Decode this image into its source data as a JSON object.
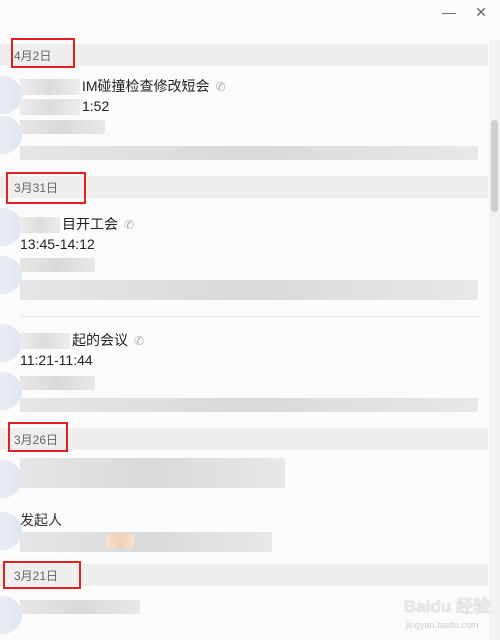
{
  "window": {
    "minimize_glyph": "—",
    "close_glyph": "✕"
  },
  "groups": [
    {
      "date": "4月2日"
    },
    {
      "date": "3月31日"
    },
    {
      "date": "3月26日"
    },
    {
      "date": "3月21日"
    }
  ],
  "meetings": [
    {
      "title": "IM碰撞检查修改短会",
      "time": "1:52",
      "call_icon": "phone-icon"
    },
    {
      "title": "目开工会",
      "time": "13:45-14:12",
      "call_icon": "phone-icon"
    },
    {
      "title": "起的会议",
      "time": "11:21-11:44",
      "call_icon": "phone-icon"
    },
    {
      "title": "",
      "time": "发起人"
    }
  ],
  "watermark": {
    "main": "Baidu 经验",
    "sub": "jingyan.baidu.com"
  },
  "colors": {
    "highlight_box": "#e02020",
    "header_bg": "#eeeeee"
  }
}
